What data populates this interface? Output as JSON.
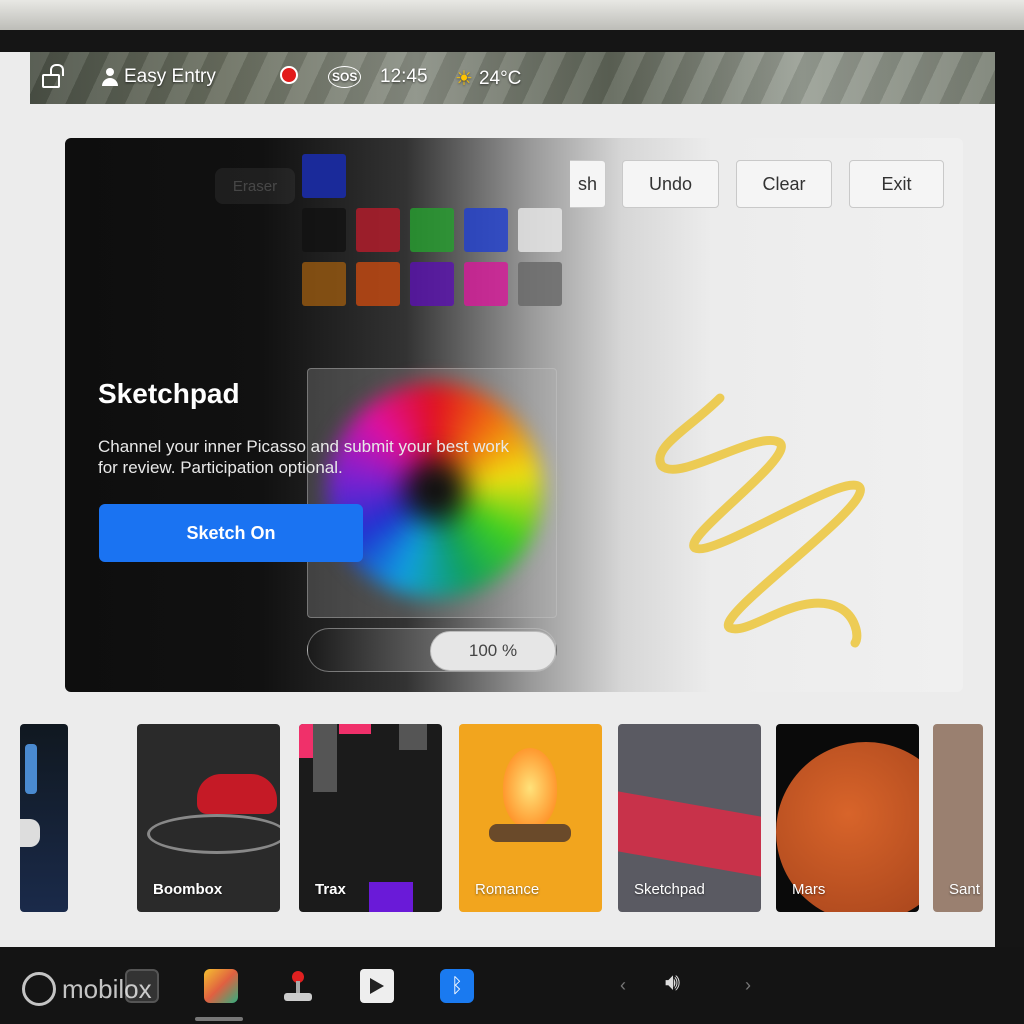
{
  "status_bar": {
    "easy_entry": "Easy Entry",
    "sos": "SOS",
    "time": "12:45",
    "temperature": "24°C"
  },
  "toolbar": {
    "brush_partial": "sh",
    "undo": "Undo",
    "clear": "Clear",
    "exit": "Exit",
    "eraser": "Eraser"
  },
  "palette": {
    "selected": "#1a2a9a",
    "colors": [
      "#111111",
      "#b81c2a",
      "#26a02e",
      "#1f3fd0",
      "#e8e8e8",
      "#9a5a10",
      "#c84a10",
      "#5a10b0",
      "#d8189a",
      "#666666"
    ]
  },
  "opacity": {
    "value": "100 %",
    "level": 1.0
  },
  "modal": {
    "title": "Sketchpad",
    "description": "Channel your inner Picasso and submit your best work for review. Participation optional.",
    "cta": "Sketch On"
  },
  "cards": [
    {
      "label": ""
    },
    {
      "label": "Boombox"
    },
    {
      "label": "Trax"
    },
    {
      "label": "Romance"
    },
    {
      "label": "Sketchpad"
    },
    {
      "label": "Mars"
    },
    {
      "label": "Sant"
    }
  ],
  "colors": {
    "accent": "#1a73f2",
    "scribble": "#ecc63a",
    "romance_bg": "#f2a51e"
  },
  "watermark": "mobilox"
}
